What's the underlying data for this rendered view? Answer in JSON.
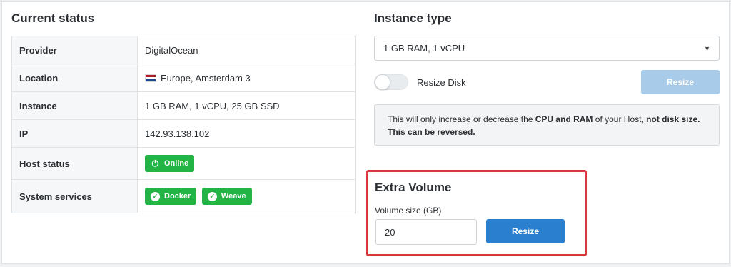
{
  "current_status": {
    "title": "Current status",
    "rows": [
      {
        "label": "Provider",
        "value": "DigitalOcean"
      },
      {
        "label": "Location",
        "value": "Europe, Amsterdam 3",
        "flag": "netherlands-flag-icon"
      },
      {
        "label": "Instance",
        "value": "1 GB RAM, 1 vCPU, 25 GB SSD"
      },
      {
        "label": "IP",
        "value": "142.93.138.102"
      },
      {
        "label": "Host status",
        "badges": [
          {
            "text": "Online",
            "icon": "power-icon"
          }
        ]
      },
      {
        "label": "System services",
        "badges": [
          {
            "text": "Docker",
            "icon": "check-circle-icon"
          },
          {
            "text": "Weave",
            "icon": "check-circle-icon"
          }
        ]
      }
    ]
  },
  "instance_type": {
    "title": "Instance type",
    "selected": "1 GB RAM, 1 vCPU",
    "resize_disk_label": "Resize Disk",
    "resize_disk_on": false,
    "resize_button": "Resize",
    "notice_part1": "This will only increase or decrease the ",
    "notice_bold1": "CPU and RAM",
    "notice_part2": " of your Host, ",
    "notice_bold2": "not disk size.",
    "notice_bold3": "This can be reversed."
  },
  "extra_volume": {
    "title": "Extra Volume",
    "size_label": "Volume size (GB)",
    "size_value": "20",
    "resize_button": "Resize"
  },
  "colors": {
    "success": "#22b444",
    "primary": "#2b7fcf",
    "primary_disabled": "#a7cbe9",
    "highlight": "#d9373d"
  }
}
